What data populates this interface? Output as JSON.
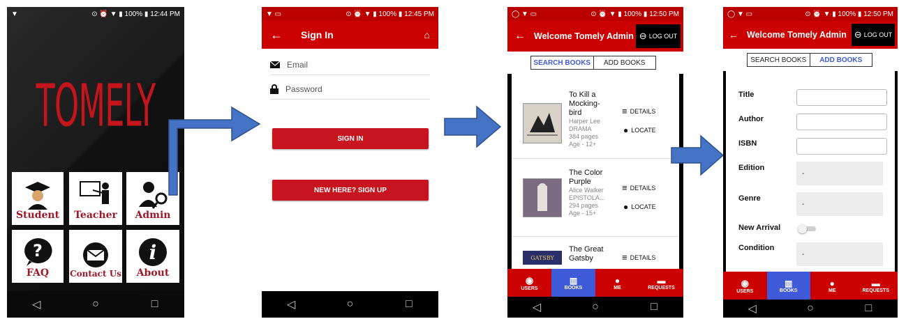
{
  "status_bars": {
    "s1_time": "12:44 PM",
    "s2_time": "12:45 PM",
    "s3_time": "12:50 PM",
    "s4_time": "12:50 PM",
    "battery": "100%"
  },
  "home": {
    "logo": "TOMELY",
    "tiles": [
      {
        "label": "Student",
        "icon": "graduate-icon"
      },
      {
        "label": "Teacher",
        "icon": "teacher-icon"
      },
      {
        "label": "Admin",
        "icon": "admin-icon"
      },
      {
        "label": "FAQ",
        "icon": "question-icon"
      },
      {
        "label": "Contact Us",
        "icon": "envelope-icon"
      },
      {
        "label": "About",
        "icon": "info-icon"
      }
    ]
  },
  "signin": {
    "title": "Sign In",
    "email_placeholder": "Email",
    "password_placeholder": "Password",
    "signin_label": "SIGN IN",
    "signup_label": "NEW HERE? SIGN UP"
  },
  "admin": {
    "title": "Welcome Tomely Admin",
    "logout_label": "LOG OUT",
    "tab_search": "SEARCH BOOKS",
    "tab_add": "ADD BOOKS",
    "details_label": "DETAILS",
    "locate_label": "LOCATE",
    "books": [
      {
        "title_lines": [
          "To Kill a",
          "Mocking-",
          "bird"
        ],
        "author": "Harper Lee",
        "genre": "DRAMA",
        "pages": "384 pages",
        "age": "Age - 12+"
      },
      {
        "title_lines": [
          "The Color",
          "Purple"
        ],
        "author": "Alice Walker",
        "genre": "EPISTOLA...",
        "pages": "294 pages",
        "age": "Age - 15+"
      },
      {
        "title_lines": [
          "The Great",
          "Gatsby"
        ],
        "cover_text": "GATSBY"
      }
    ],
    "bottom_tabs": [
      "USERS",
      "BOOKS",
      "ME",
      "REQUESTS"
    ]
  },
  "addbook": {
    "labels": {
      "title": "Title",
      "author": "Author",
      "isbn": "ISBN",
      "edition": "Edition",
      "genre": "Genre",
      "new_arrival": "New Arrival",
      "condition": "Condition"
    },
    "placeholder_dash": "-"
  },
  "colors": {
    "brand_red": "#c00000",
    "active_tab": "#3f5ad8",
    "arrow_blue": "#4472c4"
  }
}
